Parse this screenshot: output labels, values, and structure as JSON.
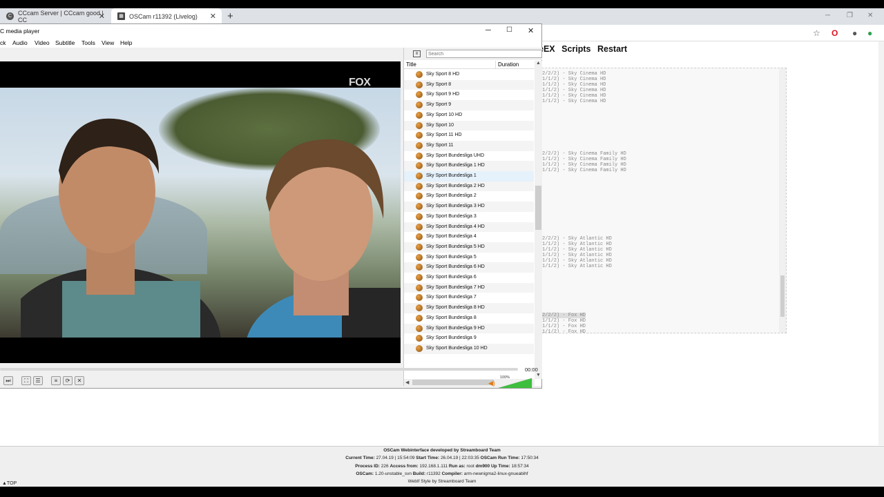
{
  "browser": {
    "tabs": [
      {
        "title": "CCcam Server | CCcam good | CC",
        "active": false
      },
      {
        "title": "OSCam r11392 (Livelog)",
        "active": true
      }
    ],
    "new_tab": "+",
    "minimize": "─",
    "restore": "❐",
    "close": "✕"
  },
  "page": {
    "nav": [
      "eEX",
      "Scripts",
      "Restart"
    ],
    "log_lines": [
      {
        "text": "2/2/2) - Sky Cinema HD",
        "hl": false
      },
      {
        "text": "1/1/2) - Sky Cinema HD",
        "hl": false
      },
      {
        "text": "1/1/2) - Sky Cinema HD",
        "hl": false
      },
      {
        "text": "1/1/2) - Sky Cinema HD",
        "hl": false
      },
      {
        "text": "1/1/2) - Sky Cinema HD",
        "hl": false
      },
      {
        "text": "1/1/2) - Sky Cinema HD",
        "hl": false
      },
      {
        "text": "2/2/2) - Sky Cinema Family HD",
        "hl": false
      },
      {
        "text": "1/1/2) - Sky Cinema Family HD",
        "hl": false
      },
      {
        "text": "1/1/2) - Sky Cinema Family HD",
        "hl": false
      },
      {
        "text": "1/1/2) - Sky Cinema Family HD",
        "hl": false
      },
      {
        "text": "2/2/2) - Sky Atlantic HD",
        "hl": false
      },
      {
        "text": "1/1/2) - Sky Atlantic HD",
        "hl": false
      },
      {
        "text": "1/1/2) - Sky Atlantic HD",
        "hl": false
      },
      {
        "text": "1/1/2) - Sky Atlantic HD",
        "hl": false
      },
      {
        "text": "1/1/2) - Sky Atlantic HD",
        "hl": false
      },
      {
        "text": "1/1/2) - Sky Atlantic HD",
        "hl": false
      },
      {
        "text": "2/2/2) - Fox HD",
        "hl": true
      },
      {
        "text": "1/1/2) - Fox HD",
        "hl": false
      },
      {
        "text": "1/1/2) - Fox HD",
        "hl": false
      },
      {
        "text": "1/1/2) - Fox HD",
        "hl": false
      }
    ],
    "footer": {
      "line1": "OSCam Webinterface developed by Streamboard Team",
      "current_time_label": "Current Time:",
      "current_time": "27.04.19 | 15:54:09",
      "start_time_label": "Start Time:",
      "start_time": "26.04.19 | 22:03:35",
      "run_time_label": "OSCam Run Time:",
      "run_time": "17:50:34",
      "pid_label": "Process ID:",
      "pid": "226",
      "access_label": "Access from:",
      "access": "192.168.1.111",
      "runas_label": "Run as:",
      "runas": "root",
      "uptime_label": "dm900 Up Time:",
      "uptime": "18:57:34",
      "oscam_label": "OSCam:",
      "oscam": "1.20-unstable_svn",
      "build_label": "Build:",
      "build": "r11392",
      "compiler_label": "Compiler:",
      "compiler": "arm-newnigma2-linux-gnueabihf",
      "style": "WebIf Style by Streamboard Team",
      "to_top": "▲TOP"
    }
  },
  "vlc": {
    "title": "C media player",
    "menu": [
      "ck",
      "Audio",
      "Video",
      "Subtitle",
      "Tools",
      "View",
      "Help"
    ],
    "watermark": "FOX",
    "search_placeholder": "Search",
    "col_title": "Title",
    "col_duration": "Duration",
    "playlist": [
      "Sky Sport 8 HD",
      "Sky Sport 8",
      "Sky Sport 9 HD",
      "Sky Sport 9",
      "Sky Sport 10 HD",
      "Sky Sport 10",
      "Sky Sport 11 HD",
      "Sky Sport 11",
      "Sky Sport Bundesliga UHD",
      "Sky Sport Bundesliga 1 HD",
      "Sky Sport Bundesliga 1",
      "Sky Sport Bundesliga 2 HD",
      "Sky Sport Bundesliga 2",
      "Sky Sport Bundesliga 3 HD",
      "Sky Sport Bundesliga 3",
      "Sky Sport Bundesliga 4 HD",
      "Sky Sport Bundesliga 4",
      "Sky Sport Bundesliga 5 HD",
      "Sky Sport Bundesliga 5",
      "Sky Sport Bundesliga 6 HD",
      "Sky Sport Bundesliga 6",
      "Sky Sport Bundesliga 7 HD",
      "Sky Sport Bundesliga 7",
      "Sky Sport Bundesliga 8 HD",
      "Sky Sport Bundesliga 8",
      "Sky Sport Bundesliga 9 HD",
      "Sky Sport Bundesliga 9",
      "Sky Sport Bundesliga 10 HD"
    ],
    "selected_index": 10,
    "time": "00:00",
    "volume_label": "100%",
    "volume_level": 1.0
  }
}
